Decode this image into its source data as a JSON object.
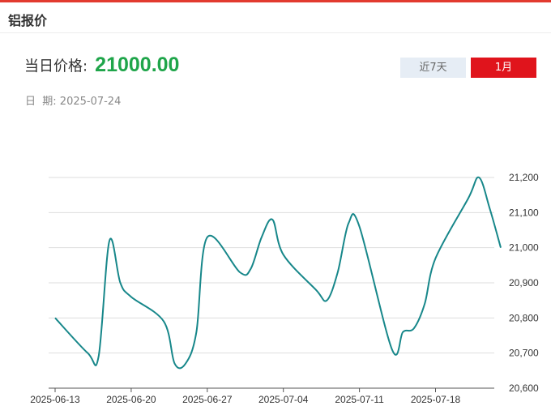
{
  "header": {
    "title": "铝报价"
  },
  "price": {
    "label": "当日价格:",
    "value": "21000.00"
  },
  "date": {
    "label": "日  期:",
    "value": "2025-07-24"
  },
  "tabs": [
    {
      "label": "近7天",
      "active": false
    },
    {
      "label": "1月",
      "active": true
    }
  ],
  "colors": {
    "accent": "#e0141c",
    "price": "#1fa54a",
    "line": "#17878a",
    "grid": "#dddddd"
  },
  "chart_data": {
    "type": "line",
    "title": "",
    "xlabel": "",
    "ylabel": "",
    "ylim": [
      20600,
      21200
    ],
    "y_ticks": [
      "20,600",
      "20,700",
      "20,800",
      "20,900",
      "21,000",
      "21,100",
      "21,200"
    ],
    "y_tick_values": [
      20600,
      20700,
      20800,
      20900,
      21000,
      21100,
      21200
    ],
    "x_tick_labels": [
      "2025-06-13",
      "2025-06-20",
      "2025-06-27",
      "2025-07-04",
      "2025-07-11",
      "2025-07-18"
    ],
    "grid": true,
    "axis_side": "right",
    "series": [
      {
        "x": [
          "2025-06-13",
          "2025-06-16",
          "2025-06-17",
          "2025-06-18",
          "2025-06-19",
          "2025-06-20",
          "2025-06-23",
          "2025-06-24",
          "2025-06-25",
          "2025-06-26",
          "2025-06-27",
          "2025-06-30",
          "2025-07-01",
          "2025-07-02",
          "2025-07-03",
          "2025-07-04",
          "2025-07-07",
          "2025-07-08",
          "2025-07-09",
          "2025-07-10",
          "2025-07-11",
          "2025-07-14",
          "2025-07-15",
          "2025-07-16",
          "2025-07-17",
          "2025-07-18",
          "2025-07-21",
          "2025-07-22",
          "2025-07-23",
          "2025-07-24"
        ],
        "values": [
          20800,
          20700,
          20690,
          21020,
          20900,
          20860,
          20790,
          20670,
          20670,
          20760,
          21030,
          20930,
          20940,
          21030,
          21080,
          20980,
          20880,
          20850,
          20930,
          21070,
          21060,
          20710,
          20760,
          20770,
          20840,
          20970,
          21140,
          21200,
          21110,
          21000
        ]
      }
    ]
  }
}
